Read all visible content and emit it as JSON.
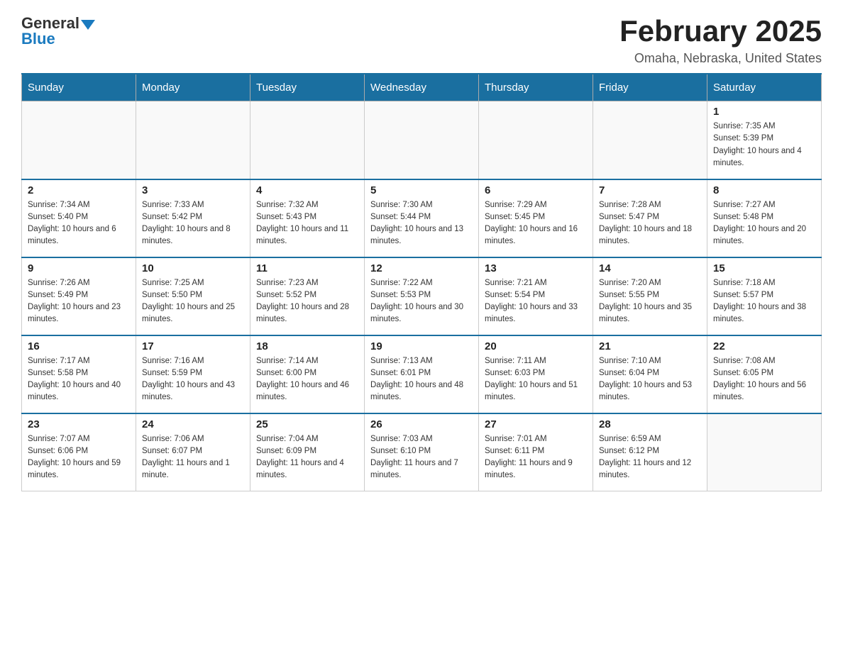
{
  "header": {
    "logo_general": "General",
    "logo_blue": "Blue",
    "title": "February 2025",
    "subtitle": "Omaha, Nebraska, United States"
  },
  "days_of_week": [
    "Sunday",
    "Monday",
    "Tuesday",
    "Wednesday",
    "Thursday",
    "Friday",
    "Saturday"
  ],
  "weeks": [
    [
      {
        "day": "",
        "info": ""
      },
      {
        "day": "",
        "info": ""
      },
      {
        "day": "",
        "info": ""
      },
      {
        "day": "",
        "info": ""
      },
      {
        "day": "",
        "info": ""
      },
      {
        "day": "",
        "info": ""
      },
      {
        "day": "1",
        "info": "Sunrise: 7:35 AM\nSunset: 5:39 PM\nDaylight: 10 hours and 4 minutes."
      }
    ],
    [
      {
        "day": "2",
        "info": "Sunrise: 7:34 AM\nSunset: 5:40 PM\nDaylight: 10 hours and 6 minutes."
      },
      {
        "day": "3",
        "info": "Sunrise: 7:33 AM\nSunset: 5:42 PM\nDaylight: 10 hours and 8 minutes."
      },
      {
        "day": "4",
        "info": "Sunrise: 7:32 AM\nSunset: 5:43 PM\nDaylight: 10 hours and 11 minutes."
      },
      {
        "day": "5",
        "info": "Sunrise: 7:30 AM\nSunset: 5:44 PM\nDaylight: 10 hours and 13 minutes."
      },
      {
        "day": "6",
        "info": "Sunrise: 7:29 AM\nSunset: 5:45 PM\nDaylight: 10 hours and 16 minutes."
      },
      {
        "day": "7",
        "info": "Sunrise: 7:28 AM\nSunset: 5:47 PM\nDaylight: 10 hours and 18 minutes."
      },
      {
        "day": "8",
        "info": "Sunrise: 7:27 AM\nSunset: 5:48 PM\nDaylight: 10 hours and 20 minutes."
      }
    ],
    [
      {
        "day": "9",
        "info": "Sunrise: 7:26 AM\nSunset: 5:49 PM\nDaylight: 10 hours and 23 minutes."
      },
      {
        "day": "10",
        "info": "Sunrise: 7:25 AM\nSunset: 5:50 PM\nDaylight: 10 hours and 25 minutes."
      },
      {
        "day": "11",
        "info": "Sunrise: 7:23 AM\nSunset: 5:52 PM\nDaylight: 10 hours and 28 minutes."
      },
      {
        "day": "12",
        "info": "Sunrise: 7:22 AM\nSunset: 5:53 PM\nDaylight: 10 hours and 30 minutes."
      },
      {
        "day": "13",
        "info": "Sunrise: 7:21 AM\nSunset: 5:54 PM\nDaylight: 10 hours and 33 minutes."
      },
      {
        "day": "14",
        "info": "Sunrise: 7:20 AM\nSunset: 5:55 PM\nDaylight: 10 hours and 35 minutes."
      },
      {
        "day": "15",
        "info": "Sunrise: 7:18 AM\nSunset: 5:57 PM\nDaylight: 10 hours and 38 minutes."
      }
    ],
    [
      {
        "day": "16",
        "info": "Sunrise: 7:17 AM\nSunset: 5:58 PM\nDaylight: 10 hours and 40 minutes."
      },
      {
        "day": "17",
        "info": "Sunrise: 7:16 AM\nSunset: 5:59 PM\nDaylight: 10 hours and 43 minutes."
      },
      {
        "day": "18",
        "info": "Sunrise: 7:14 AM\nSunset: 6:00 PM\nDaylight: 10 hours and 46 minutes."
      },
      {
        "day": "19",
        "info": "Sunrise: 7:13 AM\nSunset: 6:01 PM\nDaylight: 10 hours and 48 minutes."
      },
      {
        "day": "20",
        "info": "Sunrise: 7:11 AM\nSunset: 6:03 PM\nDaylight: 10 hours and 51 minutes."
      },
      {
        "day": "21",
        "info": "Sunrise: 7:10 AM\nSunset: 6:04 PM\nDaylight: 10 hours and 53 minutes."
      },
      {
        "day": "22",
        "info": "Sunrise: 7:08 AM\nSunset: 6:05 PM\nDaylight: 10 hours and 56 minutes."
      }
    ],
    [
      {
        "day": "23",
        "info": "Sunrise: 7:07 AM\nSunset: 6:06 PM\nDaylight: 10 hours and 59 minutes."
      },
      {
        "day": "24",
        "info": "Sunrise: 7:06 AM\nSunset: 6:07 PM\nDaylight: 11 hours and 1 minute."
      },
      {
        "day": "25",
        "info": "Sunrise: 7:04 AM\nSunset: 6:09 PM\nDaylight: 11 hours and 4 minutes."
      },
      {
        "day": "26",
        "info": "Sunrise: 7:03 AM\nSunset: 6:10 PM\nDaylight: 11 hours and 7 minutes."
      },
      {
        "day": "27",
        "info": "Sunrise: 7:01 AM\nSunset: 6:11 PM\nDaylight: 11 hours and 9 minutes."
      },
      {
        "day": "28",
        "info": "Sunrise: 6:59 AM\nSunset: 6:12 PM\nDaylight: 11 hours and 12 minutes."
      },
      {
        "day": "",
        "info": ""
      }
    ]
  ]
}
